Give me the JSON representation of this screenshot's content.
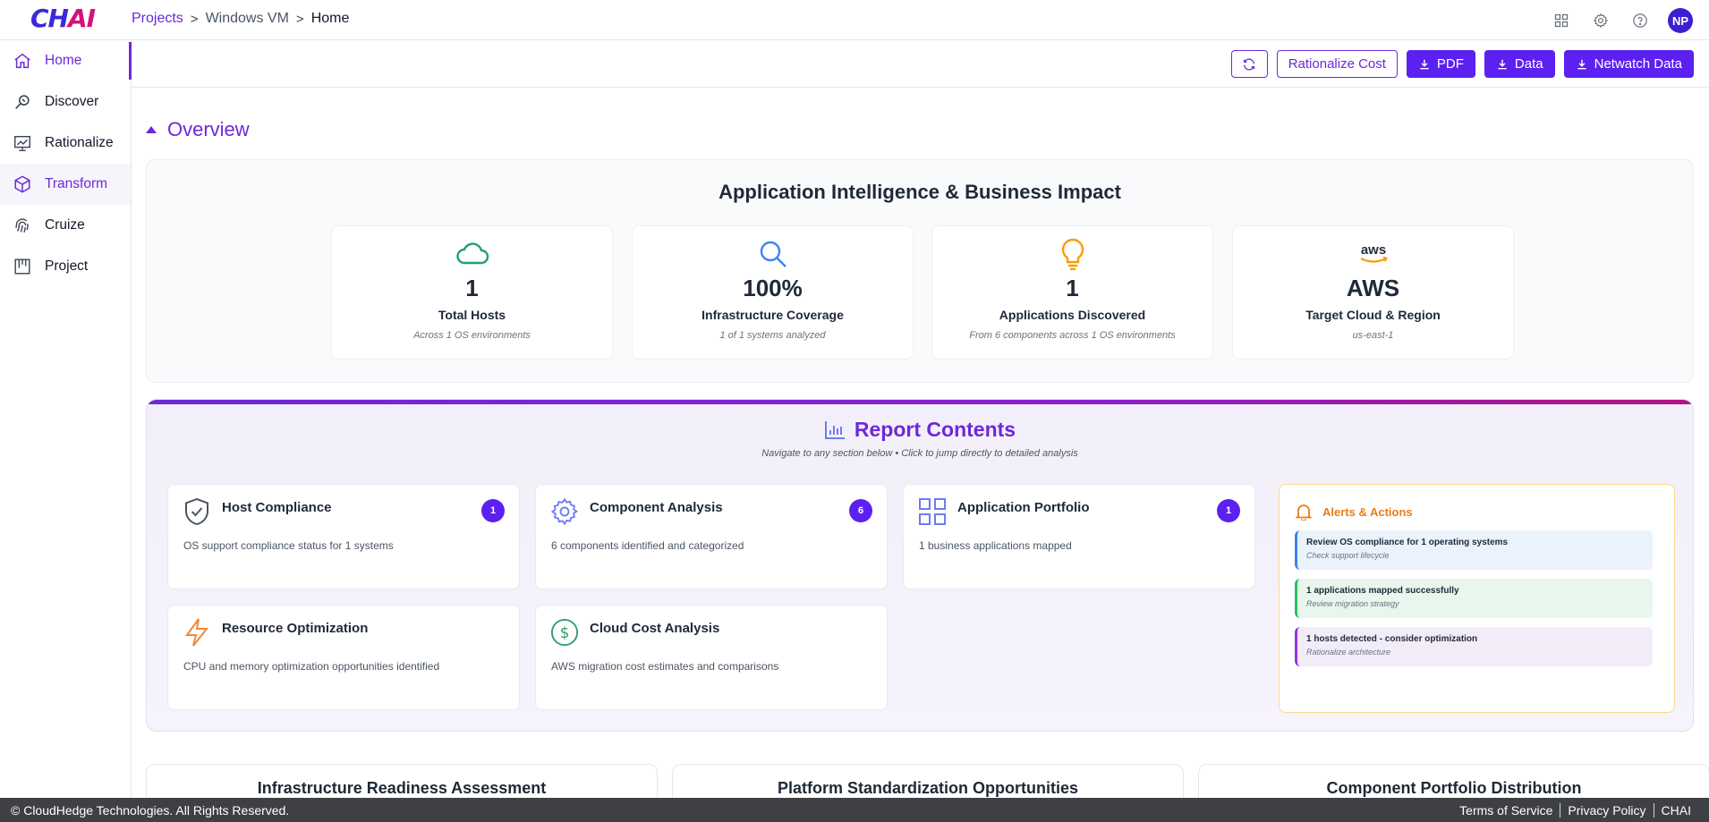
{
  "app": {
    "logo_main": "CH",
    "logo_accent": "AI"
  },
  "breadcrumb": {
    "items": [
      "Projects",
      "Windows VM",
      "Home"
    ]
  },
  "header": {
    "avatar_initials": "NP",
    "icons": [
      "grid-icon",
      "gear-icon",
      "help-icon"
    ]
  },
  "sidebar": {
    "items": [
      {
        "label": "Home",
        "icon": "home-icon"
      },
      {
        "label": "Discover",
        "icon": "discover-icon"
      },
      {
        "label": "Rationalize",
        "icon": "rationalize-icon"
      },
      {
        "label": "Transform",
        "icon": "cube-icon"
      },
      {
        "label": "Cruize",
        "icon": "fingerprint-icon"
      },
      {
        "label": "Project",
        "icon": "project-icon"
      }
    ]
  },
  "actions": {
    "rationalize_cost": "Rationalize Cost",
    "pdf": "PDF",
    "data": "Data",
    "netwatch": "Netwatch Data"
  },
  "overview": {
    "title": "Overview",
    "impact_title": "Application Intelligence & Business Impact",
    "metrics": [
      {
        "value": "1",
        "label": "Total Hosts",
        "sub": "Across 1 OS environments",
        "icon": "cloud-icon"
      },
      {
        "value": "100%",
        "label": "Infrastructure Coverage",
        "sub": "1 of 1 systems analyzed",
        "icon": "search-icon"
      },
      {
        "value": "1",
        "label": "Applications Discovered",
        "sub": "From 6 components across 1 OS environments",
        "icon": "lightbulb-icon"
      },
      {
        "value": "AWS",
        "label": "Target Cloud & Region",
        "sub": "us-east-1",
        "icon": "aws-logo-icon",
        "logo_text": "aws"
      }
    ]
  },
  "report": {
    "title": "Report Contents",
    "subtitle": "Navigate to any section below • Click to jump directly to detailed analysis",
    "cards": [
      {
        "title": "Host Compliance",
        "desc": "OS support compliance status for 1 systems",
        "badge": "1",
        "icon": "shield-check-icon"
      },
      {
        "title": "Component Analysis",
        "desc": "6 components identified and categorized",
        "badge": "6",
        "icon": "gear-icon"
      },
      {
        "title": "Application Portfolio",
        "desc": "1 business applications mapped",
        "badge": "1",
        "icon": "grid-icon"
      },
      {
        "title": "Resource Optimization",
        "desc": "CPU and memory optimization opportunities identified",
        "icon": "lightning-icon"
      },
      {
        "title": "Cloud Cost Analysis",
        "desc": "AWS migration cost estimates and comparisons",
        "icon": "dollar-icon"
      }
    ],
    "alerts": {
      "title": "Alerts & Actions",
      "items": [
        {
          "title": "Review OS compliance for 1 operating systems",
          "sub": "Check support lifecycle",
          "color": "#3b82f6"
        },
        {
          "title": "1 applications mapped successfully",
          "sub": "Review migration strategy",
          "color": "#22c55e"
        },
        {
          "title": "1 hosts detected - consider optimization",
          "sub": "Rationalize architecture",
          "color": "#9333ea"
        }
      ]
    }
  },
  "bottom_sections": [
    "Infrastructure Readiness Assessment",
    "Platform Standardization Opportunities",
    "Component Portfolio Distribution"
  ],
  "footer": {
    "copyright": "© CloudHedge Technologies. All Rights Reserved.",
    "links": [
      "Terms of Service",
      "Privacy Policy",
      "CHAI"
    ]
  },
  "colors": {
    "accent": "#6d28d9",
    "button": "#5b21f0",
    "footer": "#3f4045"
  }
}
